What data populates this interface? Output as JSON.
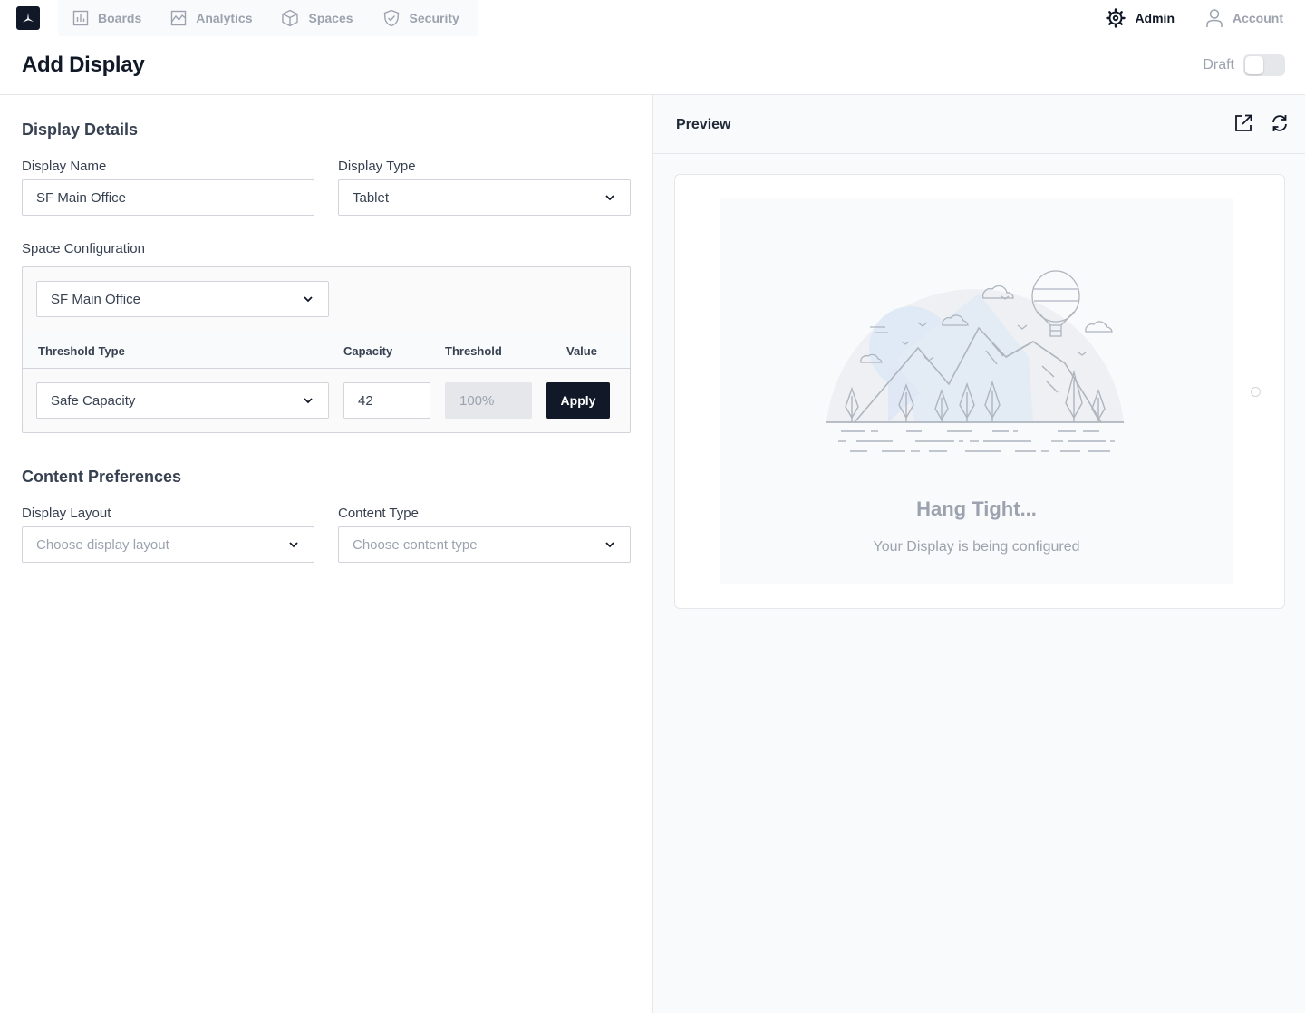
{
  "nav": {
    "tabs": [
      {
        "label": "Boards",
        "icon": "bar-chart-icon"
      },
      {
        "label": "Analytics",
        "icon": "line-chart-icon"
      },
      {
        "label": "Spaces",
        "icon": "cube-icon"
      },
      {
        "label": "Security",
        "icon": "shield-icon"
      }
    ],
    "admin_label": "Admin",
    "account_label": "Account"
  },
  "page": {
    "title": "Add Display",
    "draft_label": "Draft",
    "draft_on": false
  },
  "display_details": {
    "title": "Display Details",
    "name_label": "Display Name",
    "name_value": "SF Main Office",
    "type_label": "Display Type",
    "type_value": "Tablet"
  },
  "space_config": {
    "label": "Space Configuration",
    "selected_space": "SF Main Office",
    "columns": [
      "Threshold Type",
      "Capacity",
      "Threshold",
      "Value"
    ],
    "row": {
      "threshold_type": "Safe Capacity",
      "capacity": "42",
      "threshold": "100%",
      "apply_label": "Apply"
    }
  },
  "content_prefs": {
    "title": "Content Preferences",
    "layout_label": "Display Layout",
    "layout_placeholder": "Choose display layout",
    "content_label": "Content Type",
    "content_placeholder": "Choose content type"
  },
  "preview": {
    "title": "Preview",
    "heading": "Hang Tight...",
    "subheading": "Your Display is being configured"
  },
  "colors": {
    "primary": "#111827",
    "muted": "#9ca3af",
    "border": "#d1d5db"
  }
}
